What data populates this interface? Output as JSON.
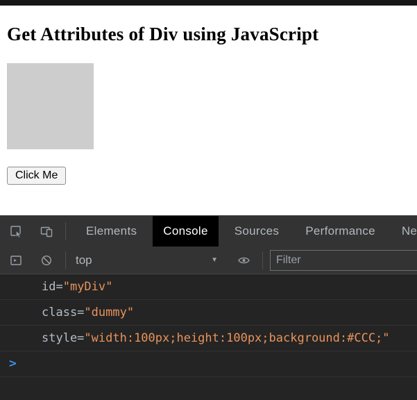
{
  "window": {
    "top_strip_color": "#161616"
  },
  "page": {
    "heading": "Get Attributes of Div using JavaScript",
    "button_label": "Click Me",
    "div_background": "#cdcdcd"
  },
  "devtools": {
    "colors": {
      "toolbar_bg": "#333333",
      "console_bg": "#242424",
      "active_tab_bg": "#000000",
      "tab_text": "#b3b8bd",
      "prompt_blue": "#3b8eea",
      "attr_name": "#b4bec8",
      "attr_value": "#e8935c"
    },
    "tab_bar": {
      "active_tab": "Console",
      "tabs": [
        {
          "label": "Elements"
        },
        {
          "label": "Console"
        },
        {
          "label": "Sources"
        },
        {
          "label": "Performance"
        },
        {
          "label": "Network"
        }
      ]
    },
    "toolbar": {
      "context_selector_value": "top",
      "filter_placeholder": "Filter"
    },
    "icons": {
      "chevron_down": "▼"
    },
    "console": {
      "prompt_symbol": ">",
      "messages": [
        {
          "segments": [
            {
              "text": "id=",
              "color": "#b4bec8"
            },
            {
              "text": "\"myDiv\"",
              "color": "#e8935c"
            }
          ]
        },
        {
          "segments": [
            {
              "text": "class=",
              "color": "#b4bec8"
            },
            {
              "text": "\"dummy\"",
              "color": "#e8935c"
            }
          ]
        },
        {
          "segments": [
            {
              "text": "style=",
              "color": "#b4bec8"
            },
            {
              "text": "\"width:100px;height:100px;background:#CCC;\"",
              "color": "#e8935c"
            }
          ]
        }
      ]
    }
  }
}
